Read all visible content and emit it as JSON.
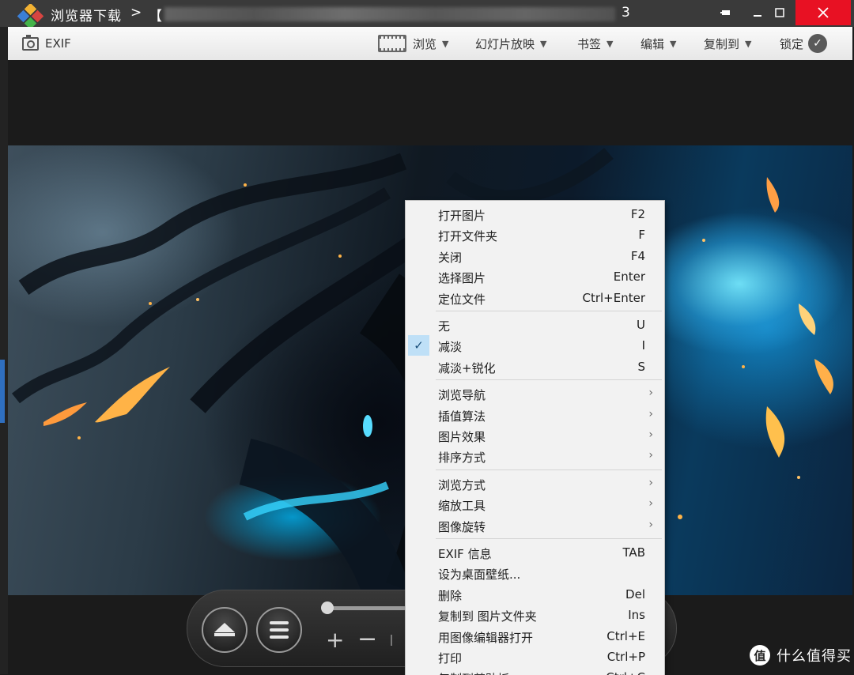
{
  "titlebar": {
    "app_name": "浏览器下载",
    "separator": ">",
    "bracket": "【",
    "file_tail": "3",
    "minimize_icon": "minimize-icon",
    "maximize_icon": "maximize-icon",
    "close_icon": "close-icon"
  },
  "toolbar": {
    "exif_label": "EXIF",
    "browse_label": "浏览",
    "slideshow_label": "幻灯片放映",
    "bookmark_label": "书签",
    "edit_label": "编辑",
    "copy_to_label": "复制到",
    "lock_label": "锁定",
    "dropdown_arrow": "▼",
    "check_glyph": "✓"
  },
  "controls": {
    "zoom_in": "+",
    "zoom_out": "−",
    "playback_position": 0.0
  },
  "context_menu": {
    "groups": [
      [
        {
          "label": "打开图片",
          "shortcut": "F2"
        },
        {
          "label": "打开文件夹",
          "shortcut": "F"
        },
        {
          "label": "关闭",
          "shortcut": "F4"
        },
        {
          "label": "选择图片",
          "shortcut": "Enter"
        },
        {
          "label": "定位文件",
          "shortcut": "Ctrl+Enter"
        }
      ],
      [
        {
          "label": "无",
          "shortcut": "U"
        },
        {
          "label": "减淡",
          "shortcut": "I",
          "checked": true
        },
        {
          "label": "减淡+锐化",
          "shortcut": "S"
        }
      ],
      [
        {
          "label": "浏览导航",
          "submenu": true
        },
        {
          "label": "插值算法",
          "submenu": true
        },
        {
          "label": "图片效果",
          "submenu": true
        },
        {
          "label": "排序方式",
          "submenu": true
        }
      ],
      [
        {
          "label": "浏览方式",
          "submenu": true
        },
        {
          "label": "缩放工具",
          "submenu": true
        },
        {
          "label": "图像旋转",
          "submenu": true
        }
      ],
      [
        {
          "label": "EXIF 信息",
          "shortcut": "TAB"
        },
        {
          "label": "设为桌面壁纸..."
        },
        {
          "label": "删除",
          "shortcut": "Del"
        },
        {
          "label": "复制到 图片文件夹",
          "shortcut": "Ins"
        },
        {
          "label": "用图像编辑器打开",
          "shortcut": "Ctrl+E"
        },
        {
          "label": "打印",
          "shortcut": "Ctrl+P"
        },
        {
          "label": "复制到剪贴板",
          "shortcut": "Ctrl+C"
        }
      ]
    ],
    "check_glyph": "✓",
    "submenu_glyph": "›"
  },
  "watermark": {
    "logo_glyph": "值",
    "text": "什么值得买"
  },
  "colors": {
    "titlebar_bg": "#3a3a3a",
    "close_button": "#e81123",
    "menu_bg": "#f2f2f2",
    "menu_check_bg": "#bfe0f7"
  }
}
